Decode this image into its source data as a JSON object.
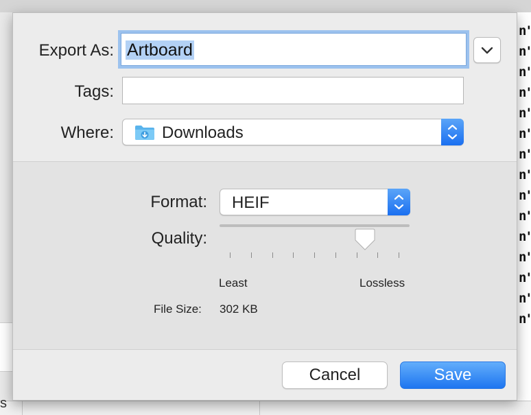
{
  "dialog": {
    "export_as_label": "Export As:",
    "export_as_value": "Artboard",
    "tags_label": "Tags:",
    "tags_value": "",
    "where_label": "Where:",
    "where_value": "Downloads",
    "format_label": "Format:",
    "format_value": "HEIF",
    "quality_label": "Quality:",
    "quality_level": 0.8,
    "quality_min_label": "Least",
    "quality_max_label": "Lossless",
    "file_size_label": "File Size:",
    "file_size_value": "302 KB",
    "cancel_label": "Cancel",
    "save_label": "Save"
  },
  "icons": {
    "expand": "chevron-down-icon",
    "where_folder": "downloads-folder-icon",
    "stepper": "up-down-chevron-icon"
  },
  "colors": {
    "accent": "#1d75f0",
    "focus_ring": "#9cc2ee",
    "selection": "#b3d1f5"
  }
}
